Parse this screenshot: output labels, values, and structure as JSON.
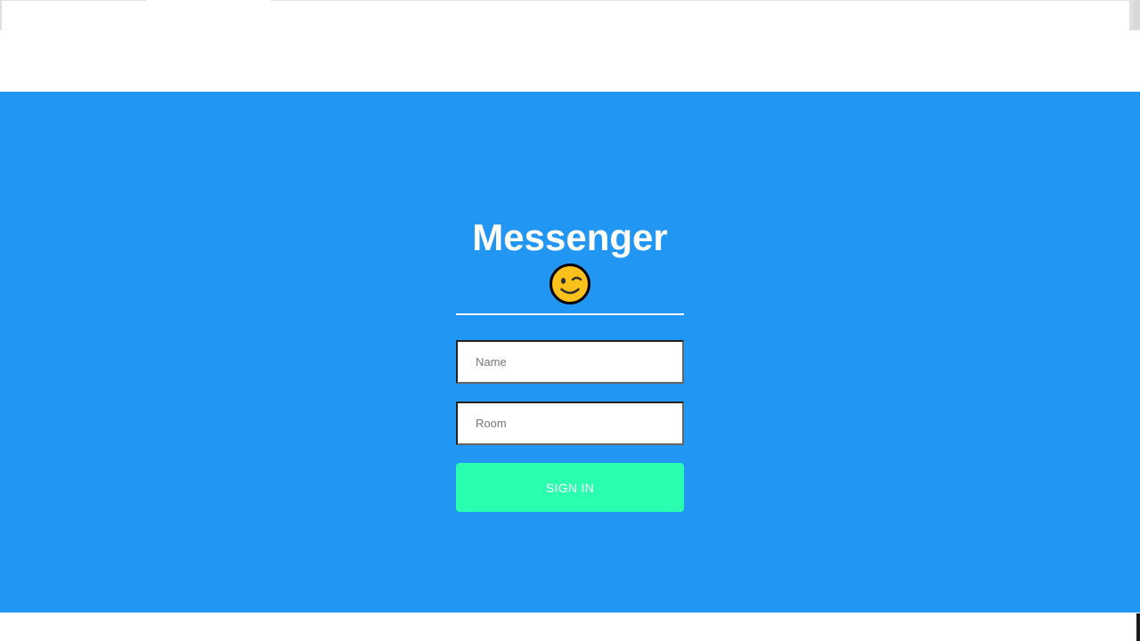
{
  "signin": {
    "title": "Messenger",
    "emoji_icon": "winking-face-icon",
    "name_placeholder": "Name",
    "room_placeholder": "Room",
    "button_label": "SIGN IN"
  },
  "colors": {
    "hero_background": "#2196f3",
    "button_background": "#2affaf",
    "text_light": "#ffffff"
  }
}
